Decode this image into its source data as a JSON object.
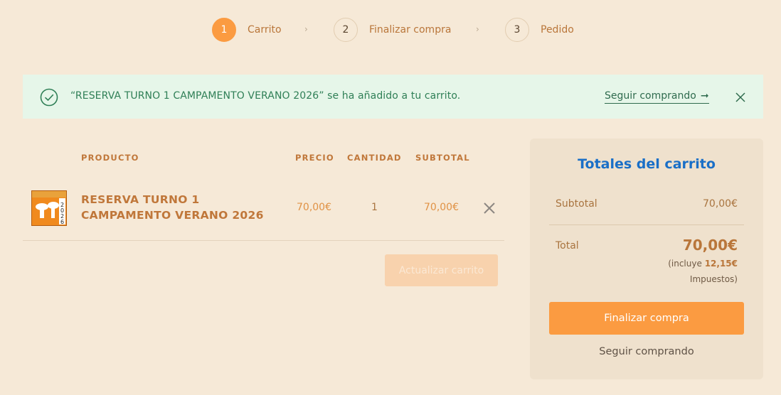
{
  "steps": [
    {
      "num": "1",
      "label": "Carrito"
    },
    {
      "num": "2",
      "label": "Finalizar compra"
    },
    {
      "num": "3",
      "label": "Pedido"
    }
  ],
  "step_separator": "›",
  "notice": {
    "message": "“RESERVA TURNO 1 CAMPAMENTO VERANO 2026” se ha añadido a tu carrito.",
    "link": "Seguir comprando",
    "link_arrow": "➞",
    "icon": "check-circle-icon",
    "close_icon": "close-icon"
  },
  "table": {
    "headers": {
      "product": "PRODUCTO",
      "price": "PRECIO",
      "quantity": "CANTIDAD",
      "subtotal": "SUBTOTAL"
    },
    "rows": [
      {
        "name": "RESERVA TURNO 1 CAMPAMENTO VERANO 2026",
        "price": "70,00€",
        "quantity": "1",
        "subtotal": "70,00€",
        "thumb_year": "2026"
      }
    ],
    "update_button": "Actualizar carrito"
  },
  "totals": {
    "title": "Totales del carrito",
    "subtotal_label": "Subtotal",
    "subtotal_value": "70,00€",
    "total_label": "Total",
    "total_value": "70,00€",
    "tax_prefix": "(incluye",
    "tax_amount": "12,15€",
    "tax_suffix": "Impuestos)",
    "checkout_button": "Finalizar compra",
    "continue_link": "Seguir comprando"
  },
  "colors": {
    "accent": "#fb9b41",
    "background": "#f6e9d7",
    "notice_bg": "#e6f6e9",
    "title_blue": "#1a6fc7"
  }
}
